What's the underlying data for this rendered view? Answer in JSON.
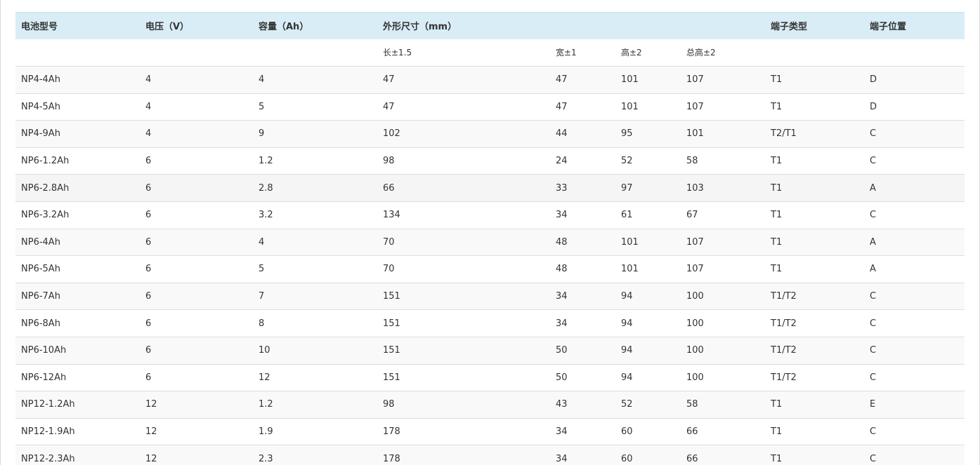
{
  "header": {
    "model": "电池型号",
    "voltage": "电压（V）",
    "capacity": "容量（Ah）",
    "dimensions": "外形尺寸（mm）",
    "terminal_type": "端子类型",
    "terminal_position": "端子位置"
  },
  "subheader": {
    "length": "长±1.5",
    "width": "宽±1",
    "height": "高±2",
    "total_height": "总高±2"
  },
  "rows": [
    [
      "NP4-4Ah",
      "4",
      "4",
      "47",
      "47",
      "101",
      "107",
      "T1",
      "D"
    ],
    [
      "NP4-5Ah",
      "4",
      "5",
      "47",
      "47",
      "101",
      "107",
      "T1",
      "D"
    ],
    [
      "NP4-9Ah",
      "4",
      "9",
      "102",
      "44",
      "95",
      "101",
      "T2/T1",
      "C"
    ],
    [
      "NP6-1.2Ah",
      "6",
      "1.2",
      "98",
      "24",
      "52",
      "58",
      "T1",
      "C"
    ],
    [
      "NP6-2.8Ah",
      "6",
      "2.8",
      "66",
      "33",
      "97",
      "103",
      "T1",
      "A"
    ],
    [
      "NP6-3.2Ah",
      "6",
      "3.2",
      "134",
      "34",
      "61",
      "67",
      "T1",
      "C"
    ],
    [
      "NP6-4Ah",
      "6",
      "4",
      "70",
      "48",
      "101",
      "107",
      "T1",
      "A"
    ],
    [
      "NP6-5Ah",
      "6",
      "5",
      "70",
      "48",
      "101",
      "107",
      "T1",
      "A"
    ],
    [
      "NP6-7Ah",
      "6",
      "7",
      "151",
      "34",
      "94",
      "100",
      "T1/T2",
      "C"
    ],
    [
      "NP6-8Ah",
      "6",
      "8",
      "151",
      "34",
      "94",
      "100",
      "T1/T2",
      "C"
    ],
    [
      "NP6-10Ah",
      "6",
      "10",
      "151",
      "50",
      "94",
      "100",
      "T1/T2",
      "C"
    ],
    [
      "NP6-12Ah",
      "6",
      "12",
      "151",
      "50",
      "94",
      "100",
      "T1/T2",
      "C"
    ],
    [
      "NP12-1.2Ah",
      "12",
      "1.2",
      "98",
      "43",
      "52",
      "58",
      "T1",
      "E"
    ],
    [
      "NP12-1.9Ah",
      "12",
      "1.9",
      "178",
      "34",
      "60",
      "66",
      "T1",
      "C"
    ],
    [
      "NP12-2.3Ah",
      "12",
      "2.3",
      "178",
      "34",
      "60",
      "66",
      "T1",
      "C"
    ]
  ],
  "hovered_row": 4,
  "colors": {
    "header_bg": "#d9edf7",
    "odd_row_bg": "#f9f9f9",
    "hover_row_bg": "#f5f5f5",
    "border": "#dddddd"
  }
}
